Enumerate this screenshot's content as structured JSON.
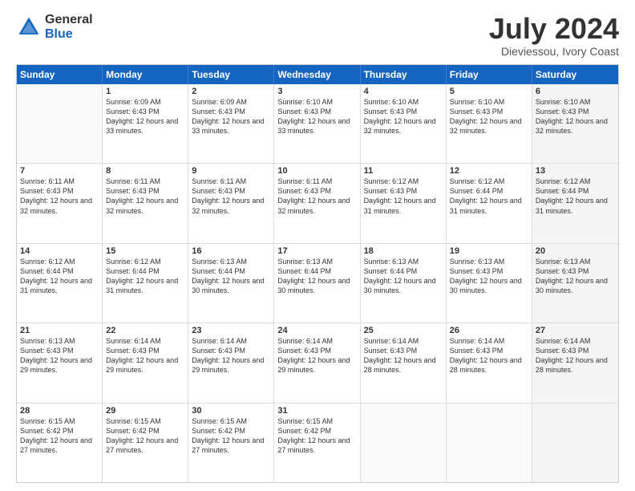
{
  "logo": {
    "general": "General",
    "blue": "Blue"
  },
  "title": "July 2024",
  "location": "Dieviessou, Ivory Coast",
  "days": [
    "Sunday",
    "Monday",
    "Tuesday",
    "Wednesday",
    "Thursday",
    "Friday",
    "Saturday"
  ],
  "rows": [
    [
      {
        "day": "",
        "empty": true
      },
      {
        "day": "1",
        "sunrise": "6:09 AM",
        "sunset": "6:43 PM",
        "daylight": "12 hours and 33 minutes."
      },
      {
        "day": "2",
        "sunrise": "6:09 AM",
        "sunset": "6:43 PM",
        "daylight": "12 hours and 33 minutes."
      },
      {
        "day": "3",
        "sunrise": "6:10 AM",
        "sunset": "6:43 PM",
        "daylight": "12 hours and 33 minutes."
      },
      {
        "day": "4",
        "sunrise": "6:10 AM",
        "sunset": "6:43 PM",
        "daylight": "12 hours and 32 minutes."
      },
      {
        "day": "5",
        "sunrise": "6:10 AM",
        "sunset": "6:43 PM",
        "daylight": "12 hours and 32 minutes."
      },
      {
        "day": "6",
        "sunrise": "6:10 AM",
        "sunset": "6:43 PM",
        "daylight": "12 hours and 32 minutes.",
        "shaded": true
      }
    ],
    [
      {
        "day": "7",
        "sunrise": "6:11 AM",
        "sunset": "6:43 PM",
        "daylight": "12 hours and 32 minutes."
      },
      {
        "day": "8",
        "sunrise": "6:11 AM",
        "sunset": "6:43 PM",
        "daylight": "12 hours and 32 minutes."
      },
      {
        "day": "9",
        "sunrise": "6:11 AM",
        "sunset": "6:43 PM",
        "daylight": "12 hours and 32 minutes."
      },
      {
        "day": "10",
        "sunrise": "6:11 AM",
        "sunset": "6:43 PM",
        "daylight": "12 hours and 32 minutes."
      },
      {
        "day": "11",
        "sunrise": "6:12 AM",
        "sunset": "6:43 PM",
        "daylight": "12 hours and 31 minutes."
      },
      {
        "day": "12",
        "sunrise": "6:12 AM",
        "sunset": "6:44 PM",
        "daylight": "12 hours and 31 minutes."
      },
      {
        "day": "13",
        "sunrise": "6:12 AM",
        "sunset": "6:44 PM",
        "daylight": "12 hours and 31 minutes.",
        "shaded": true
      }
    ],
    [
      {
        "day": "14",
        "sunrise": "6:12 AM",
        "sunset": "6:44 PM",
        "daylight": "12 hours and 31 minutes."
      },
      {
        "day": "15",
        "sunrise": "6:12 AM",
        "sunset": "6:44 PM",
        "daylight": "12 hours and 31 minutes."
      },
      {
        "day": "16",
        "sunrise": "6:13 AM",
        "sunset": "6:44 PM",
        "daylight": "12 hours and 30 minutes."
      },
      {
        "day": "17",
        "sunrise": "6:13 AM",
        "sunset": "6:44 PM",
        "daylight": "12 hours and 30 minutes."
      },
      {
        "day": "18",
        "sunrise": "6:13 AM",
        "sunset": "6:44 PM",
        "daylight": "12 hours and 30 minutes."
      },
      {
        "day": "19",
        "sunrise": "6:13 AM",
        "sunset": "6:43 PM",
        "daylight": "12 hours and 30 minutes."
      },
      {
        "day": "20",
        "sunrise": "6:13 AM",
        "sunset": "6:43 PM",
        "daylight": "12 hours and 30 minutes.",
        "shaded": true
      }
    ],
    [
      {
        "day": "21",
        "sunrise": "6:13 AM",
        "sunset": "6:43 PM",
        "daylight": "12 hours and 29 minutes."
      },
      {
        "day": "22",
        "sunrise": "6:14 AM",
        "sunset": "6:43 PM",
        "daylight": "12 hours and 29 minutes."
      },
      {
        "day": "23",
        "sunrise": "6:14 AM",
        "sunset": "6:43 PM",
        "daylight": "12 hours and 29 minutes."
      },
      {
        "day": "24",
        "sunrise": "6:14 AM",
        "sunset": "6:43 PM",
        "daylight": "12 hours and 29 minutes."
      },
      {
        "day": "25",
        "sunrise": "6:14 AM",
        "sunset": "6:43 PM",
        "daylight": "12 hours and 28 minutes."
      },
      {
        "day": "26",
        "sunrise": "6:14 AM",
        "sunset": "6:43 PM",
        "daylight": "12 hours and 28 minutes."
      },
      {
        "day": "27",
        "sunrise": "6:14 AM",
        "sunset": "6:43 PM",
        "daylight": "12 hours and 28 minutes.",
        "shaded": true
      }
    ],
    [
      {
        "day": "28",
        "sunrise": "6:15 AM",
        "sunset": "6:42 PM",
        "daylight": "12 hours and 27 minutes."
      },
      {
        "day": "29",
        "sunrise": "6:15 AM",
        "sunset": "6:42 PM",
        "daylight": "12 hours and 27 minutes."
      },
      {
        "day": "30",
        "sunrise": "6:15 AM",
        "sunset": "6:42 PM",
        "daylight": "12 hours and 27 minutes."
      },
      {
        "day": "31",
        "sunrise": "6:15 AM",
        "sunset": "6:42 PM",
        "daylight": "12 hours and 27 minutes."
      },
      {
        "day": "",
        "empty": true
      },
      {
        "day": "",
        "empty": true
      },
      {
        "day": "",
        "empty": true,
        "shaded": true
      }
    ]
  ]
}
